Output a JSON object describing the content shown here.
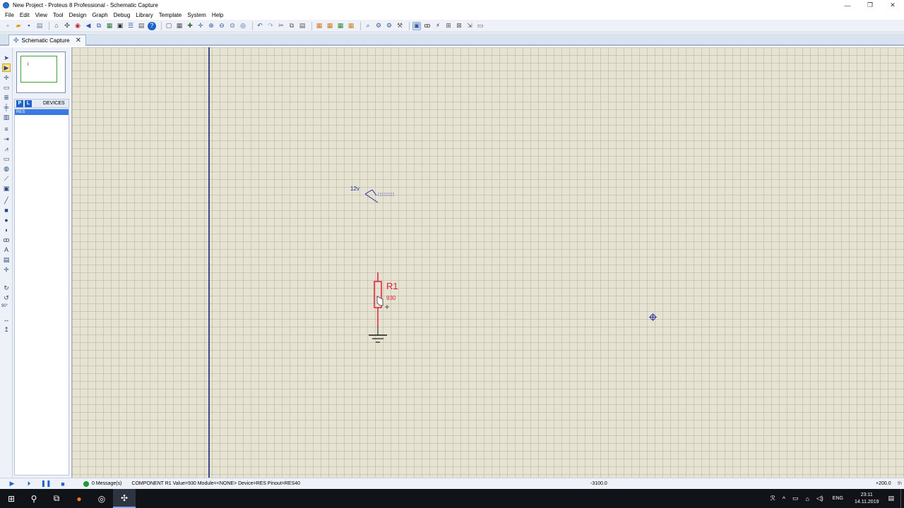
{
  "window": {
    "title": "New Project - Proteus 8 Professional - Schematic Capture",
    "controls": [
      "—",
      "❐",
      "✕"
    ]
  },
  "menu": [
    "File",
    "Edit",
    "View",
    "Tool",
    "Design",
    "Graph",
    "Debug",
    "Library",
    "Template",
    "System",
    "Help"
  ],
  "tab": {
    "label": "Schematic Capture",
    "close": "✕"
  },
  "side_panel": {
    "p_button": "P",
    "l_button": "L",
    "devices_title": "DEVICES",
    "devices": [
      "RES"
    ]
  },
  "toolstrip": {
    "rotate_angle": "90°"
  },
  "schematic": {
    "power_label": "12v",
    "component_ref": "R1",
    "component_value": "930"
  },
  "status": {
    "messages": "0 Message(s)",
    "component_info": "COMPONENT R1  Value=930  Module=<NONE>  Device=RES  Pinout=RES40",
    "coord_x": "-3100.0",
    "coord_y": "+200.0",
    "unit": "th"
  },
  "taskbar": {
    "language": "ENG",
    "time": "23:11",
    "date": "14.11.2019"
  },
  "colors": {
    "canvas": "#e6e3d3",
    "component": "#e0203a",
    "wire_label": "#2828a0",
    "selection": "#3b7ae2"
  }
}
